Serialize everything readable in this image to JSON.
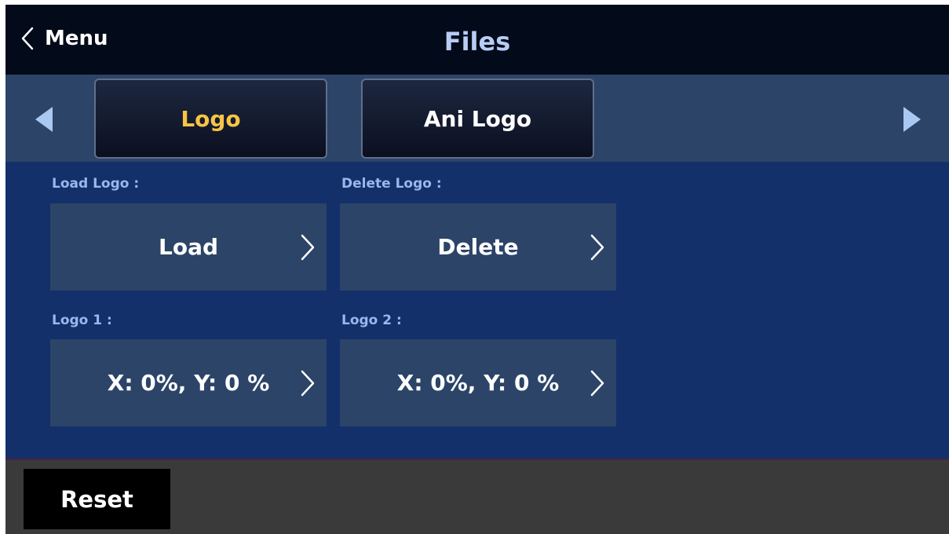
{
  "header": {
    "back_label": "Menu",
    "title": "Files"
  },
  "tabs": [
    {
      "label": "Logo",
      "selected": true
    },
    {
      "label": "Ani Logo",
      "selected": false
    }
  ],
  "sections": {
    "load": {
      "label": "Load Logo :",
      "button": "Load"
    },
    "delete": {
      "label": "Delete Logo :",
      "button": "Delete"
    },
    "logo1": {
      "label": "Logo 1 :",
      "value": "X: 0%, Y: 0 %"
    },
    "logo2": {
      "label": "Logo 2 :",
      "value": "X: 0%, Y: 0 %"
    }
  },
  "footer": {
    "reset_label": "Reset"
  },
  "colors": {
    "header_bg": "#030a1a",
    "title": "#b7cdf5",
    "content_bg": "#13306a",
    "card_bg": "#2c4468",
    "selected_tab_text": "#f8c446",
    "label_text": "#9ab8ee",
    "footer_bg": "#3a3a3a"
  },
  "icons": {
    "back": "chevron-left-icon",
    "prev": "triangle-left-icon",
    "next": "triangle-right-icon",
    "card_arrow": "chevron-right-icon"
  }
}
